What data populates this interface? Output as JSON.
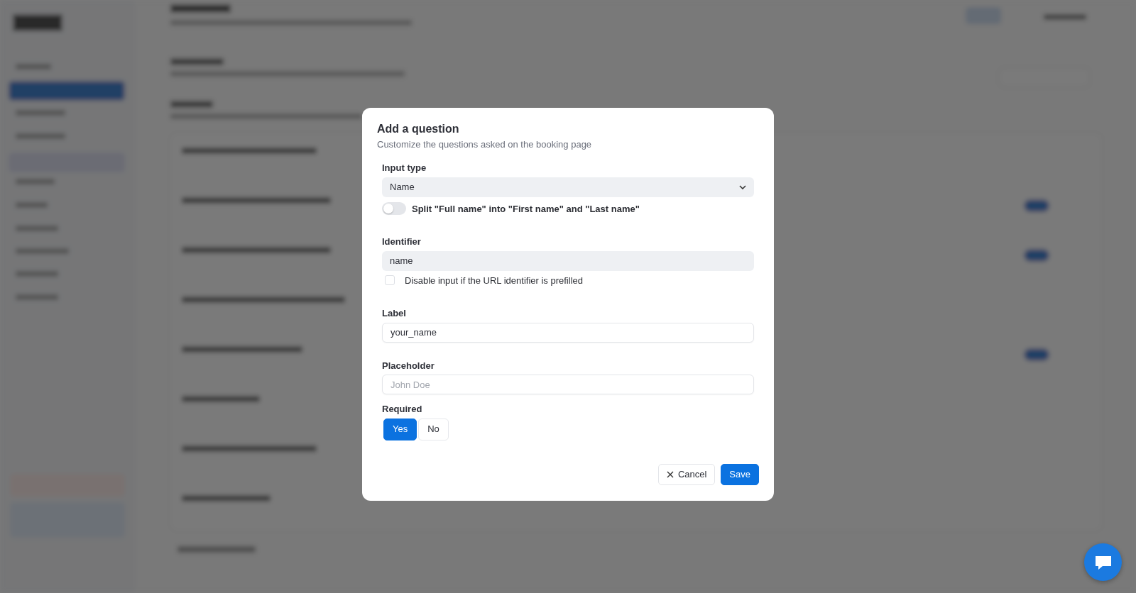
{
  "dialog": {
    "title": "Add a question",
    "subtitle": "Customize the questions asked on the booking page",
    "input_type": {
      "label": "Input type",
      "value": "Name"
    },
    "split_toggle": {
      "label": "Split \"Full name\" into \"First name\" and \"Last name\"",
      "on": false
    },
    "identifier": {
      "label": "Identifier",
      "value": "name"
    },
    "disable_checkbox": {
      "label": "Disable input if the URL identifier is prefilled",
      "checked": false
    },
    "label_field": {
      "label": "Label",
      "value": "your_name"
    },
    "placeholder_field": {
      "label": "Placeholder",
      "placeholder": "John Doe"
    },
    "required": {
      "label": "Required",
      "options": [
        {
          "label": "Yes",
          "selected": true
        },
        {
          "label": "No",
          "selected": false
        }
      ]
    },
    "buttons": [
      {
        "label": "Cancel",
        "kind": "cancel"
      },
      {
        "label": "Save",
        "kind": "save"
      }
    ]
  }
}
